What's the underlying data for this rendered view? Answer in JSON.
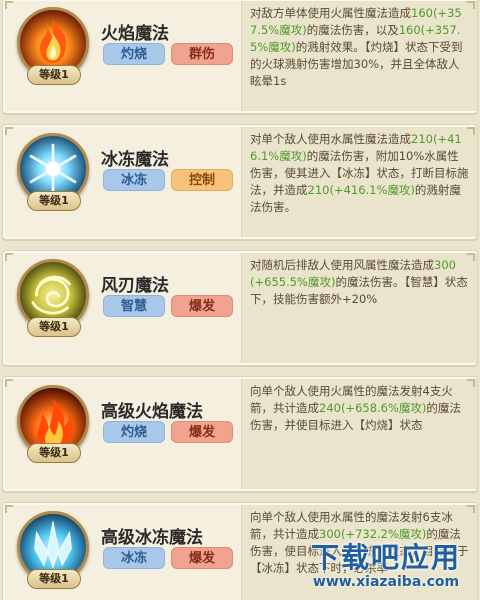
{
  "skills": [
    {
      "name": "火焰魔法",
      "level": "等级1",
      "icon": "fire-icon",
      "tags": [
        "灼烧",
        "群伤"
      ],
      "desc": [
        {
          "t": "对敌方单体使用火属性魔法造成"
        },
        {
          "t": "160(+357.5%魔攻)",
          "hl": true
        },
        {
          "t": "的魔法伤害，以及"
        },
        {
          "t": "160(+357.5%魔攻)",
          "hl": true
        },
        {
          "t": "的溅射效果。【灼烧】状态下受到的火球溅射伤害增加30%，并且全体敌人眩晕1s"
        }
      ]
    },
    {
      "name": "冰冻魔法",
      "level": "等级1",
      "icon": "ice-icon",
      "tags": [
        "冰冻",
        "控制"
      ],
      "desc": [
        {
          "t": "对单个敌人使用水属性魔法造成"
        },
        {
          "t": "210(+416.1%魔攻)",
          "hl": true
        },
        {
          "t": "的魔法伤害，附加10%水属性伤害，使其进入【冰冻】状态，打断目标施法，并造成"
        },
        {
          "t": "210(+416.1%魔攻)",
          "hl": true
        },
        {
          "t": "的溅射魔法伤害。"
        }
      ]
    },
    {
      "name": "风刃魔法",
      "level": "等级1",
      "icon": "wind-icon",
      "tags": [
        "智慧",
        "爆发"
      ],
      "desc": [
        {
          "t": "对随机后排敌人使用风属性魔法造成"
        },
        {
          "t": "300(+655.5%魔攻)",
          "hl": true
        },
        {
          "t": "的魔法伤害。【智慧】状态下，技能伤害额外+20%"
        }
      ]
    },
    {
      "name": "高级火焰魔法",
      "level": "等级1",
      "icon": "fire-icon",
      "tags": [
        "灼烧",
        "爆发"
      ],
      "desc": [
        {
          "t": "向单个敌人使用火属性的魔法发射4支火箭，共计造成"
        },
        {
          "t": "240(+658.6%魔攻)",
          "hl": true
        },
        {
          "t": "的魔法伤害，并使目标进入【灼烧】状态"
        }
      ]
    },
    {
      "name": "高级冰冻魔法",
      "level": "等级1",
      "icon": "ice-crystal-icon",
      "tags": [
        "冰冻",
        "爆发"
      ],
      "desc": [
        {
          "t": "向单个敌人使用水属性的魔法发射6支冰箭，共计造成"
        },
        {
          "t": "300(+732.2%魔攻)",
          "hl": true
        },
        {
          "t": "的魔法伤害，使目标进入【冰冻】状态，目标处于【冰冻】状态下时，必杀率"
        }
      ]
    }
  ],
  "watermark": {
    "main": "下载吧应用",
    "url": "www.xiazaiba.com"
  }
}
